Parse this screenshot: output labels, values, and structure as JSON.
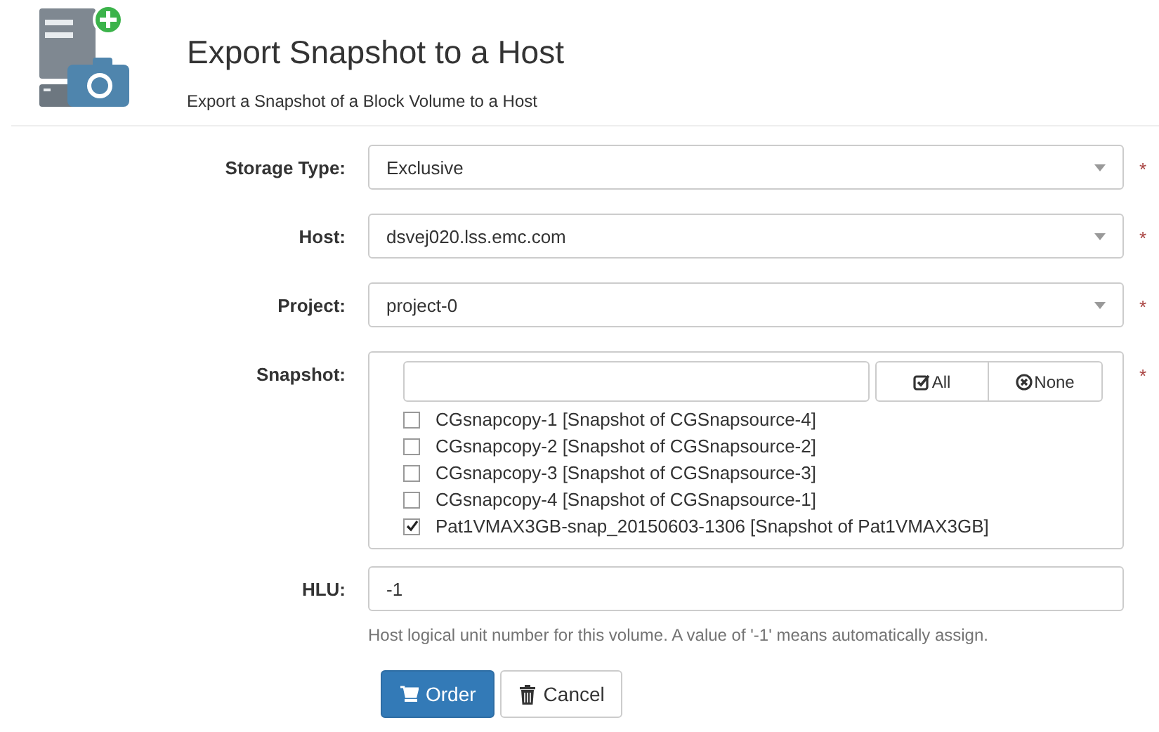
{
  "header": {
    "title": "Export Snapshot to a Host",
    "subtitle": "Export a Snapshot of a Block Volume to a Host"
  },
  "fields": [
    {
      "kind": "select",
      "label": "Storage Type:",
      "value": "Exclusive",
      "required_mark": "*"
    },
    {
      "kind": "select",
      "label": "Host:",
      "value": "dsvej020.lss.emc.com",
      "required_mark": "*"
    },
    {
      "kind": "select",
      "label": "Project:",
      "value": "project-0",
      "required_mark": "*"
    },
    {
      "kind": "checklist",
      "label": "Snapshot:",
      "required_mark": "*",
      "buttons": [
        {
          "kind": "all",
          "label": "All"
        },
        {
          "kind": "none",
          "label": "None"
        }
      ],
      "options": [
        {
          "label": "CGsnapcopy-1 [Snapshot of CGSnapsource-4]",
          "checked": false
        },
        {
          "label": "CGsnapcopy-2 [Snapshot of CGSnapsource-2]",
          "checked": false
        },
        {
          "label": "CGsnapcopy-3 [Snapshot of CGSnapsource-3]",
          "checked": false
        },
        {
          "label": "CGsnapcopy-4 [Snapshot of CGSnapsource-1]",
          "checked": false
        },
        {
          "label": "Pat1VMAX3GB-snap_20150603-1306 [Snapshot of Pat1VMAX3GB]",
          "checked": true
        }
      ]
    },
    {
      "kind": "text",
      "label": "HLU:",
      "value": "-1",
      "help": "Host logical unit number for this volume. A value of '-1' means automatically assign."
    }
  ],
  "actions": [
    {
      "kind": "primary",
      "label": "Order"
    },
    {
      "kind": "default",
      "label": "Cancel"
    }
  ]
}
